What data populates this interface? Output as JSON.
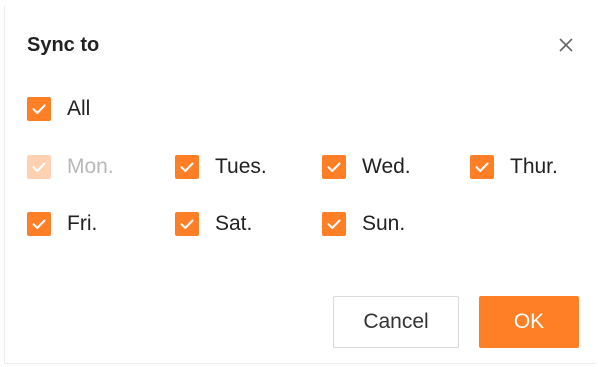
{
  "dialog": {
    "title": "Sync to",
    "close_icon": "close-icon"
  },
  "checkboxes": {
    "all": {
      "label": "All",
      "checked": true,
      "disabled": false
    },
    "days": [
      {
        "label": "Mon.",
        "checked": true,
        "disabled": true
      },
      {
        "label": "Tues.",
        "checked": true,
        "disabled": false
      },
      {
        "label": "Wed.",
        "checked": true,
        "disabled": false
      },
      {
        "label": "Thur.",
        "checked": true,
        "disabled": false
      },
      {
        "label": "Fri.",
        "checked": true,
        "disabled": false
      },
      {
        "label": "Sat.",
        "checked": true,
        "disabled": false
      },
      {
        "label": "Sun.",
        "checked": true,
        "disabled": false
      }
    ]
  },
  "buttons": {
    "cancel_label": "Cancel",
    "ok_label": "OK"
  },
  "colors": {
    "accent": "#ff7f27",
    "accent_disabled": "#ffd1b3",
    "text": "#222222",
    "text_disabled": "#b8b8b8"
  }
}
